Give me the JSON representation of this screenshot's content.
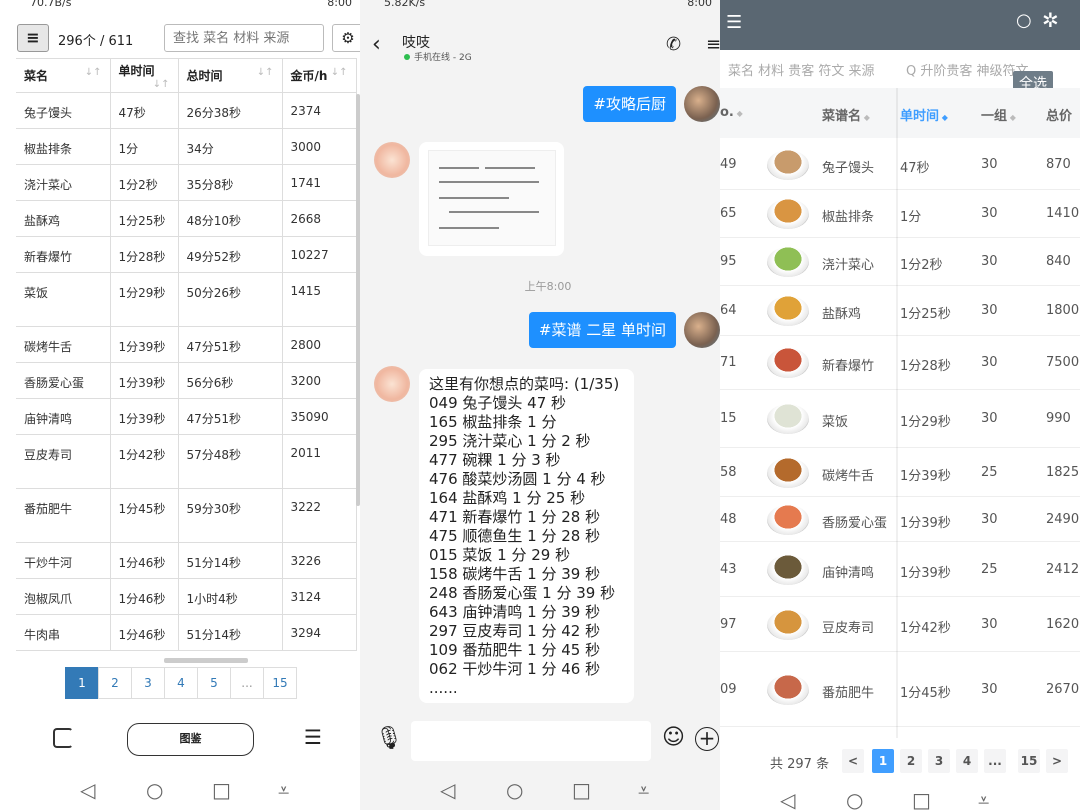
{
  "panel1": {
    "status_left": "70.7B/s",
    "status_right": "8:00",
    "menu_icon": "≡",
    "count": "296个 / 611",
    "search_placeholder": "查找 菜名 材料 来源",
    "gear_icon": "gear-icon",
    "columns": [
      "菜名",
      "单时间",
      "总时间",
      "金币/h"
    ],
    "rows": [
      {
        "name": "兔子馒头",
        "unit": "47秒",
        "total": "26分38秒",
        "gold": "2374"
      },
      {
        "name": "椒盐排条",
        "unit": "1分",
        "total": "34分",
        "gold": "3000"
      },
      {
        "name": "浇汁菜心",
        "unit": "1分2秒",
        "total": "35分8秒",
        "gold": "1741"
      },
      {
        "name": "盐酥鸡",
        "unit": "1分25秒",
        "total": "48分10秒",
        "gold": "2668"
      },
      {
        "name": "新春爆竹",
        "unit": "1分28秒",
        "total": "49分52秒",
        "gold": "10227"
      },
      {
        "name": "菜饭",
        "unit": "1分29秒",
        "total": "50分26秒",
        "gold": "1415"
      },
      {
        "name": "碳烤牛舌",
        "unit": "1分39秒",
        "total": "47分51秒",
        "gold": "2800"
      },
      {
        "name": "香肠爱心蛋",
        "unit": "1分39秒",
        "total": "56分6秒",
        "gold": "3200"
      },
      {
        "name": "庙钟清鸣",
        "unit": "1分39秒",
        "total": "47分51秒",
        "gold": "35090"
      },
      {
        "name": "豆皮寿司",
        "unit": "1分42秒",
        "total": "57分48秒",
        "gold": "2011"
      },
      {
        "name": "番茄肥牛",
        "unit": "1分45秒",
        "total": "59分30秒",
        "gold": "3222"
      },
      {
        "name": "干炒牛河",
        "unit": "1分46秒",
        "total": "51分14秒",
        "gold": "3226"
      },
      {
        "name": "泡椒凤爪",
        "unit": "1分46秒",
        "total": "1小时4秒",
        "gold": "3124"
      },
      {
        "name": "牛肉串",
        "unit": "1分46秒",
        "total": "51分14秒",
        "gold": "3294"
      }
    ],
    "pages": [
      "1",
      "2",
      "3",
      "4",
      "5",
      "...",
      "15"
    ],
    "bottom_button": "图鉴"
  },
  "panel2": {
    "status_left": "5.82K/s",
    "status_right": "8:00",
    "contact": "吱吱",
    "contact_status": "手机在线 - 2G",
    "msg1": "#攻略后厨",
    "time": "上午8:00",
    "msg2": "#菜谱 二星 单时间",
    "reply": "这里有你想点的菜吗: (1/35)\n049 兔子馒头 47 秒\n165 椒盐排条 1 分\n295 浇汁菜心 1 分 2 秒\n477 碗粿 1 分 3 秒\n476 酸菜炒汤圆 1 分 4 秒\n164 盐酥鸡 1 分 25 秒\n471 新春爆竹 1 分 28 秒\n475 顺德鱼生 1 分 28 秒\n015 菜饭 1 分 29 秒\n158 碳烤牛舌 1 分 39 秒\n248 香肠爱心蛋 1 分 39 秒\n643 庙钟清鸣 1 分 39 秒\n297 豆皮寿司 1 分 42 秒\n109 番茄肥牛 1 分 45 秒\n062 干炒牛河 1 分 46 秒\n......"
  },
  "panel3": {
    "filter1": "菜名 材料 贵客 符文 来源",
    "filter2": "Q 升阶贵客 神级符文",
    "select_all": "全选",
    "columns": [
      "o.",
      "菜谱名",
      "单时间",
      "一组",
      "总价"
    ],
    "rows": [
      {
        "no": "49",
        "name": "兔子馒头",
        "unit": "47秒",
        "group": "30",
        "price": "870",
        "color": "#c89b6c"
      },
      {
        "no": "65",
        "name": "椒盐排条",
        "unit": "1分",
        "group": "30",
        "price": "1410",
        "color": "#d99542"
      },
      {
        "no": "95",
        "name": "浇汁菜心",
        "unit": "1分2秒",
        "group": "30",
        "price": "840",
        "color": "#8fbf55"
      },
      {
        "no": "64",
        "name": "盐酥鸡",
        "unit": "1分25秒",
        "group": "30",
        "price": "1800",
        "color": "#e0a238"
      },
      {
        "no": "71",
        "name": "新春爆竹",
        "unit": "1分28秒",
        "group": "30",
        "price": "7500",
        "color": "#c9553a"
      },
      {
        "no": "15",
        "name": "菜饭",
        "unit": "1分29秒",
        "group": "30",
        "price": "990",
        "color": "#dfe3d5"
      },
      {
        "no": "58",
        "name": "碳烤牛舌",
        "unit": "1分39秒",
        "group": "25",
        "price": "1825",
        "color": "#b46a2c"
      },
      {
        "no": "48",
        "name": "香肠爱心蛋",
        "unit": "1分39秒",
        "group": "30",
        "price": "2490",
        "color": "#e57a4f"
      },
      {
        "no": "43",
        "name": "庙钟清鸣",
        "unit": "1分39秒",
        "group": "25",
        "price": "24125",
        "color": "#6b5a3a"
      },
      {
        "no": "97",
        "name": "豆皮寿司",
        "unit": "1分42秒",
        "group": "30",
        "price": "1620",
        "color": "#d6953e"
      },
      {
        "no": "09",
        "name": "番茄肥牛",
        "unit": "1分45秒",
        "group": "30",
        "price": "2670",
        "color": "#c7684a"
      }
    ],
    "total": "共 297 条",
    "pages": [
      "<",
      "1",
      "2",
      "3",
      "4",
      "...",
      "15",
      ">"
    ]
  }
}
